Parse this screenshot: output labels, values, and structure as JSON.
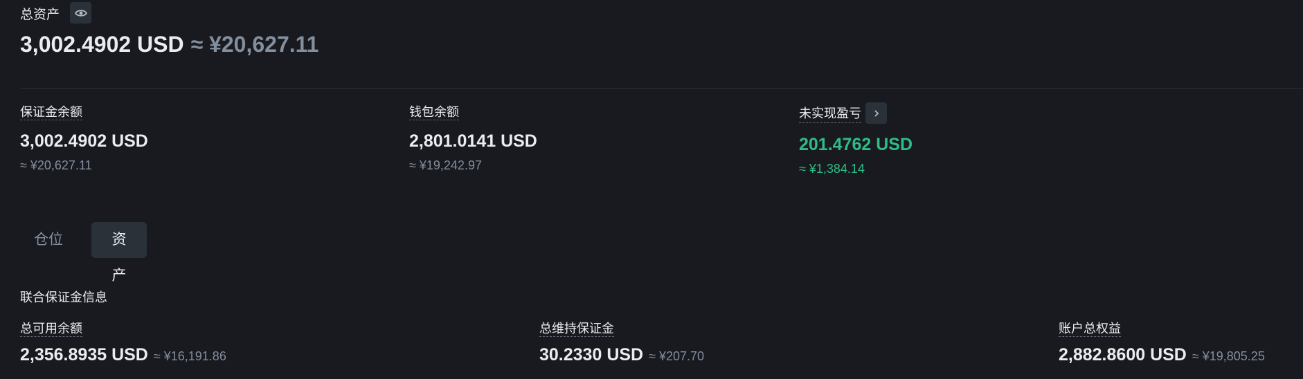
{
  "header": {
    "title": "总资产",
    "eye_icon": "eye-icon",
    "total_value": "3,002.4902 USD",
    "total_cny": "≈ ¥20,627.11"
  },
  "summary": {
    "margin_balance": {
      "label": "保证金余额",
      "value": "3,002.4902 USD",
      "cny": "≈ ¥20,627.11"
    },
    "wallet_balance": {
      "label": "钱包余额",
      "value": "2,801.0141 USD",
      "cny": "≈ ¥19,242.97"
    },
    "unrealized_pnl": {
      "label": "未实现盈亏",
      "value": "201.4762 USD",
      "cny": "≈ ¥1,384.14",
      "color": "#2ebd85",
      "arrow_icon": "chevron-right-icon"
    }
  },
  "tabs": [
    {
      "label": "仓位",
      "active": false
    },
    {
      "label": "资产",
      "active": true
    }
  ],
  "cross_margin": {
    "title": "联合保证金信息",
    "available": {
      "label": "总可用余额",
      "value": "2,356.8935 USD",
      "cny": "≈ ¥16,191.86"
    },
    "maintenance": {
      "label": "总维持保证金",
      "value": "30.2330 USD",
      "cny": "≈ ¥207.70"
    },
    "equity": {
      "label": "账户总权益",
      "value": "2,882.8600 USD",
      "cny": "≈ ¥19,805.25"
    }
  },
  "colors": {
    "background": "#181a20",
    "panel": "#2b3139",
    "positive": "#2ebd85",
    "muted": "#848e9c"
  }
}
